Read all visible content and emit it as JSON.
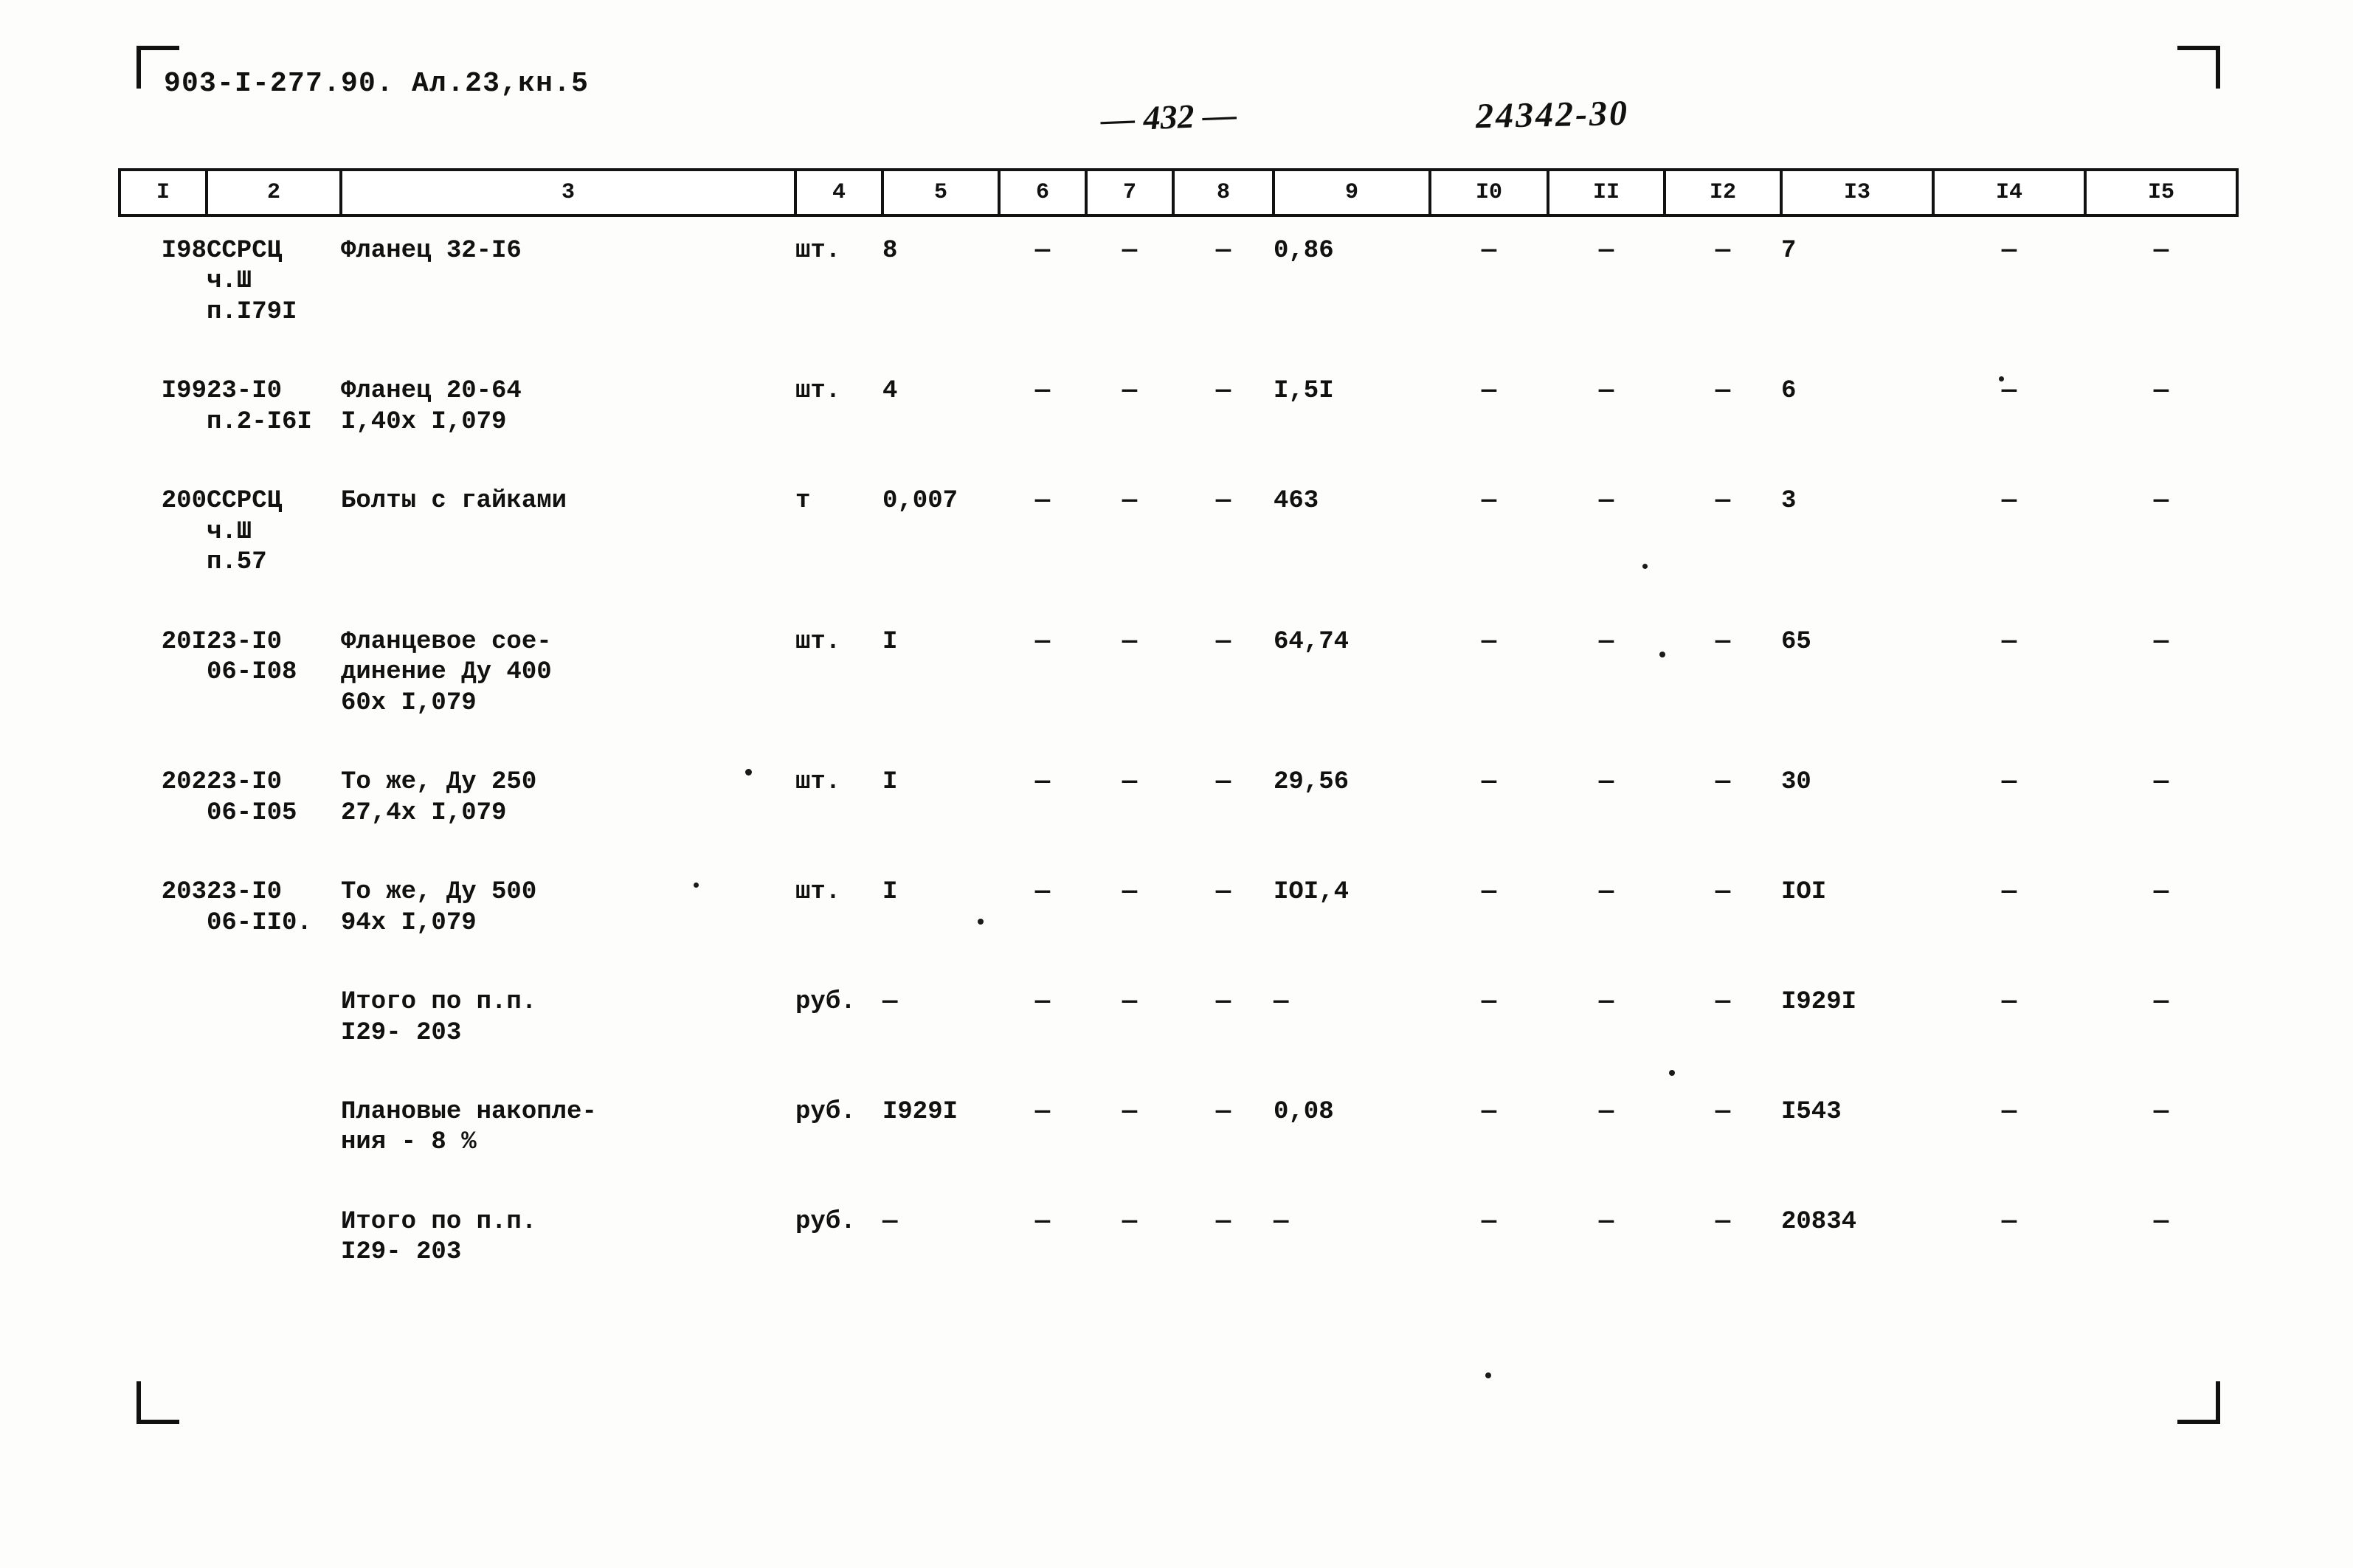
{
  "header": {
    "doc_code": "903-I-277.90. Ал.23,кн.5",
    "page_number": "— 432 —",
    "stamp_number": "24342-30"
  },
  "table": {
    "column_headers": [
      "I",
      "2",
      "3",
      "4",
      "5",
      "6",
      "7",
      "8",
      "9",
      "I0",
      "II",
      "I2",
      "I3",
      "I4",
      "I5"
    ],
    "rows": [
      {
        "pos": "I98",
        "code": "ССРСЦ\nч.Ш\nп.I79I",
        "name": "Фланец 32-I6",
        "unit": "шт.",
        "c5": "8",
        "c6": "—",
        "c7": "—",
        "c8": "—",
        "c9": "0,86",
        "c10": "—",
        "c11": "—",
        "c12": "—",
        "c13": "7",
        "c14": "—",
        "c15": "—"
      },
      {
        "pos": "I99",
        "code": "23-I0\nп.2-I6I",
        "name": "Фланец 20-64\nI,40x I,079",
        "unit": "шт.",
        "c5": "4",
        "c6": "—",
        "c7": "—",
        "c8": "—",
        "c9": "I,5I",
        "c10": "—",
        "c11": "—",
        "c12": "—",
        "c13": "6",
        "c14": "—",
        "c15": "—"
      },
      {
        "pos": "200",
        "code": "ССРСЦ\nч.Ш\nп.57",
        "name": "Болты с гайками",
        "unit": "т",
        "c5": "0,007",
        "c6": "—",
        "c7": "—",
        "c8": "—",
        "c9": "463",
        "c10": "—",
        "c11": "—",
        "c12": "—",
        "c13": "3",
        "c14": "—",
        "c15": "—"
      },
      {
        "pos": "20I",
        "code": "23-I0\n06-I08",
        "name": "Фланцевое сое-\nдинение  Ду 400\n60x I,079",
        "unit": "шт.",
        "c5": "I",
        "c6": "—",
        "c7": "—",
        "c8": "—",
        "c9": "64,74",
        "c10": "—",
        "c11": "—",
        "c12": "—",
        "c13": "65",
        "c14": "—",
        "c15": "—"
      },
      {
        "pos": "202",
        "code": "23-I0\n06-I05",
        "name": "То же, Ду 250\n27,4x I,079",
        "unit": "шт.",
        "c5": "I",
        "c6": "—",
        "c7": "—",
        "c8": "—",
        "c9": "29,56",
        "c10": "—",
        "c11": "—",
        "c12": "—",
        "c13": "30",
        "c14": "—",
        "c15": "—"
      },
      {
        "pos": "203",
        "code": "23-I0\n06-II0.",
        "name": "То же, Ду 500\n94x I,079",
        "unit": "шт.",
        "c5": "I",
        "c6": "—",
        "c7": "—",
        "c8": "—",
        "c9": "IOI,4",
        "c10": "—",
        "c11": "—",
        "c12": "—",
        "c13": "IOI",
        "c14": "—",
        "c15": "—"
      },
      {
        "pos": "",
        "code": "",
        "name": "Итого по п.п.\n   I29- 203",
        "unit": "руб.",
        "c5": "—",
        "c6": "—",
        "c7": "—",
        "c8": "—",
        "c9": "—",
        "c10": "—",
        "c11": "—",
        "c12": "—",
        "c13": "I929I",
        "c14": "—",
        "c15": "—"
      },
      {
        "pos": "",
        "code": "",
        "name": "Плановые накопле-\nния - 8 %",
        "unit": "руб.",
        "c5": "I929I",
        "c6": "—",
        "c7": "—",
        "c8": "—",
        "c9": "0,08",
        "c10": "—",
        "c11": "—",
        "c12": "—",
        "c13": "I543",
        "c14": "—",
        "c15": "—"
      },
      {
        "pos": "",
        "code": "",
        "name": "Итого по п.п.\n   I29- 203",
        "unit": "руб.",
        "c5": "—",
        "c6": "—",
        "c7": "—",
        "c8": "—",
        "c9": "—",
        "c10": "—",
        "c11": "—",
        "c12": "—",
        "c13": "20834",
        "c14": "—",
        "c15": "—"
      }
    ]
  }
}
